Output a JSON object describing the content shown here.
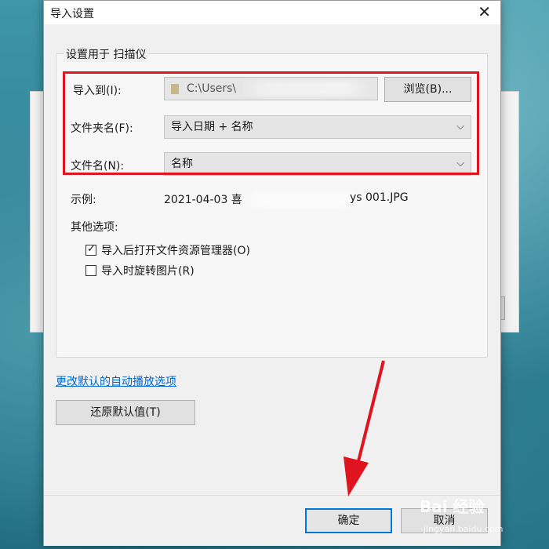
{
  "dialog": {
    "title": "导入设置",
    "close_glyph": "✕",
    "group_title": "设置用于 扫描仪",
    "import_to": {
      "label": "导入到(I):",
      "path": "C:\\Users\\",
      "browse_label": "浏览(B)..."
    },
    "folder_name": {
      "label": "文件夹名(F):",
      "value": "导入日期 + 名称"
    },
    "file_name": {
      "label": "文件名(N):",
      "value": "名称"
    },
    "example": {
      "label": "示例:",
      "prefix": "2021-04-03 喜",
      "suffix": "ys 001.JPG"
    },
    "other_options": {
      "label": "其他选项:",
      "options": [
        {
          "label": "导入后打开文件资源管理器(O)",
          "checked": true
        },
        {
          "label": "导入时旋转图片(R)",
          "checked": false
        }
      ]
    },
    "change_defaults_link": "更改默认的自动播放选项",
    "restore_defaults_label": "还原默认值(T)",
    "ok_label": "确定",
    "cancel_label": "取消",
    "chevron_glyph": "⌵"
  },
  "watermark": {
    "main": "Bai 经验",
    "sub": "jingyan.baidu.com"
  },
  "colors": {
    "highlight_red": "#e0141e",
    "focus_blue": "#0078d7",
    "link_blue": "#0066cc"
  }
}
